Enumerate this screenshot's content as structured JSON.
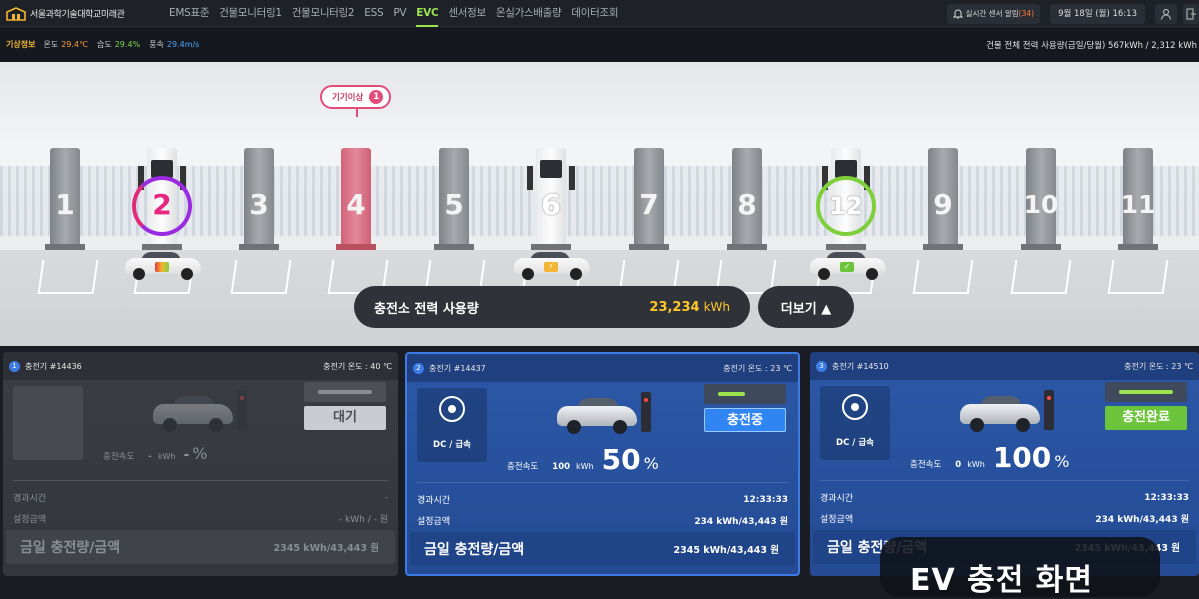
{
  "app": {
    "title": "서울과학기술대학교미래관"
  },
  "nav": {
    "items": [
      {
        "label": "EMS표준",
        "active": false
      },
      {
        "label": "건물모니터링1",
        "active": false
      },
      {
        "label": "건물모니터링2",
        "active": false
      },
      {
        "label": "ESS",
        "active": false
      },
      {
        "label": "PV",
        "active": false
      },
      {
        "label": "EVC",
        "active": true
      },
      {
        "label": "센서정보",
        "active": false
      },
      {
        "label": "온실가스배출량",
        "active": false
      },
      {
        "label": "데이터조회",
        "active": false
      }
    ]
  },
  "topright": {
    "alarm_label": "실시간 센서 알림",
    "alarm_count": "(34)",
    "datetime": "9월 18일 (월) 16:13"
  },
  "weather": {
    "label": "기상정보",
    "temp_label": "온도",
    "temp_value": "29.4℃",
    "humidity_label": "습도",
    "humidity_value": "29.4%",
    "wind_label": "풍속",
    "wind_value": "29.4m/s",
    "building_usage": "건물 전체 전력 사용량(금일/당월)  567kWh / 2,312 kWh"
  },
  "scene": {
    "chargers": [
      "1",
      "2",
      "3",
      "4",
      "5",
      "6",
      "7",
      "8",
      "12",
      "9",
      "10",
      "11"
    ],
    "alert_label": "기기이상",
    "alert_count": "1",
    "usage_label": "충전소 전력 사용량",
    "usage_value": "23,234",
    "usage_unit": "kWh",
    "more_label": "더보기 ▲"
  },
  "panels": [
    {
      "index": "1",
      "name": "충전기 #14436",
      "temp": "충전기 온도 : 40 ℃",
      "type": "",
      "speed_label": "충전속도",
      "speed_value": "-",
      "speed_unit": "kWh",
      "percent": "-",
      "percent_unit": "%",
      "state": "대기",
      "elapsed_label": "경과시간",
      "elapsed_value": "-",
      "set_label": "설정금액",
      "set_value": "- kWh / - 원",
      "total_label": "금일 충전량/금액",
      "total_value": "2345 kWh/43,443 원"
    },
    {
      "index": "2",
      "name": "충전기 #14437",
      "temp": "충전기 온도 : 23 ℃",
      "type": "DC / 급속",
      "speed_label": "충전속도",
      "speed_value": "100",
      "speed_unit": "kWh",
      "percent": "50",
      "percent_unit": "%",
      "progress": 0.5,
      "state": "충전중",
      "elapsed_label": "경과시간",
      "elapsed_value": "12:33:33",
      "set_label": "설정금액",
      "set_value": "234 kWh/43,443 원",
      "total_label": "금일 충전량/금액",
      "total_value": "2345 kWh/43,443 원"
    },
    {
      "index": "3",
      "name": "충전기 #14510",
      "temp": "충전기 온도 : 23 ℃",
      "type": "DC / 급속",
      "speed_label": "충전속도",
      "speed_value": "0",
      "speed_unit": "kWh",
      "percent": "100",
      "percent_unit": "%",
      "progress": 1.0,
      "state": "충전완료",
      "elapsed_label": "경과시간",
      "elapsed_value": "12:33:33",
      "set_label": "설정금액",
      "set_value": "234 kWh/43,443 원",
      "total_label": "금일 충전량/금액",
      "total_value": "2345 kWh/43,443 원"
    }
  ],
  "overlay": {
    "caption": "EV 충전 화면"
  }
}
